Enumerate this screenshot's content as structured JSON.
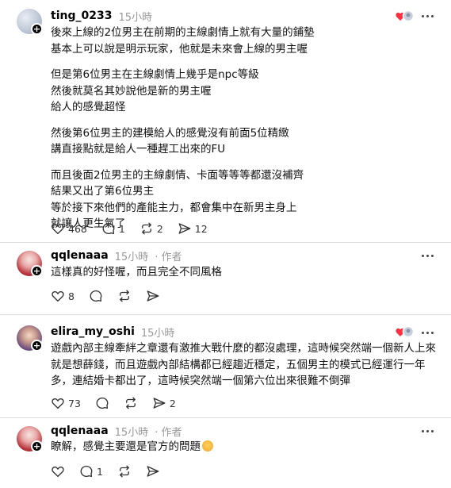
{
  "posts": [
    {
      "username": "ting_0233",
      "time": "15小時",
      "paragraphs": [
        [
          "後來上線的2位男主在前期的主線劇情上就有大量的鋪墊",
          "基本上可以說是明示玩家，他就是未來會上線的男主喔"
        ],
        [
          "但是第6位男主在主線劇情上幾乎是npc等級",
          "然後就莫名其妙說他是新的男主喔",
          "給人的感覺超怪"
        ],
        [
          "然後第6位男主的建模給人的感覺沒有前面5位精緻",
          "講直接點就是給人一種趕工出來的FU"
        ],
        [
          "而且後面2位男主的主線劇情、卡面等等等都還沒補齊",
          "結果又出了第6位男主",
          "等於接下來他們的產能主力，都會集中在新男主身上",
          "就讓人更生氣了"
        ]
      ],
      "likes": "468",
      "replies": "1",
      "reposts": "2",
      "shares": "12"
    },
    {
      "username": "qqlenaaa",
      "time": "15小時",
      "author": "· 作者",
      "paragraphs": [
        [
          "這樣真的好怪喔，而且完全不同風格"
        ]
      ],
      "likes": "8"
    },
    {
      "username": "elira_my_oshi",
      "time": "15小時",
      "paragraphs": [
        [
          "遊戲內部主線牽絆之章還有激推大戰什麼的都沒處理，這時候突然端一個新人上來",
          "就是想薛錢，而且遊戲內部結構都已經趨近穩定，五個男主的模式已經運行一年",
          "多，連結婚卡都出了，這時候突然端一個第六位出來很難不倒彈"
        ]
      ],
      "likes": "73",
      "shares": "2"
    },
    {
      "username": "qqlenaaa",
      "time": "15小時",
      "author": "· 作者",
      "text": "瞭解，感覺主要還是官方的問題",
      "replies": "1"
    }
  ],
  "colors": {
    "liked_heart": "#ff3040",
    "divider": "#dcdcdc",
    "muted": "#999999"
  }
}
